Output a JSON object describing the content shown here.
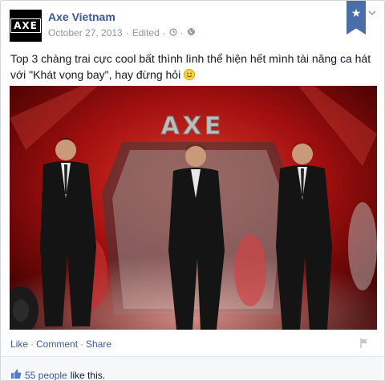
{
  "page": {
    "name": "Axe Vietnam",
    "avatar_text": "AXE"
  },
  "meta": {
    "date": "October 27, 2013",
    "separator": "·",
    "edited": "Edited"
  },
  "post": {
    "text": "Top 3 chàng trai cực cool bất thình lình thể hiện hết mình tài năng ca hát với \"Khát vọng bay\", hay đừng hỏi"
  },
  "photo": {
    "stage_text": "AXE",
    "icon": "concert-photo"
  },
  "actions": {
    "like": "Like",
    "comment": "Comment",
    "share": "Share",
    "separator": "·"
  },
  "likes": {
    "count_text": "55 people",
    "suffix": "like this."
  },
  "colors": {
    "link": "#3b5998",
    "meta": "#90949c",
    "ribbon": "#4a6ea8"
  },
  "icons": {
    "ribbon": "star-icon",
    "menu": "chevron-down-icon",
    "privacy": "globe-icon",
    "like": "thumbs-up-icon"
  }
}
